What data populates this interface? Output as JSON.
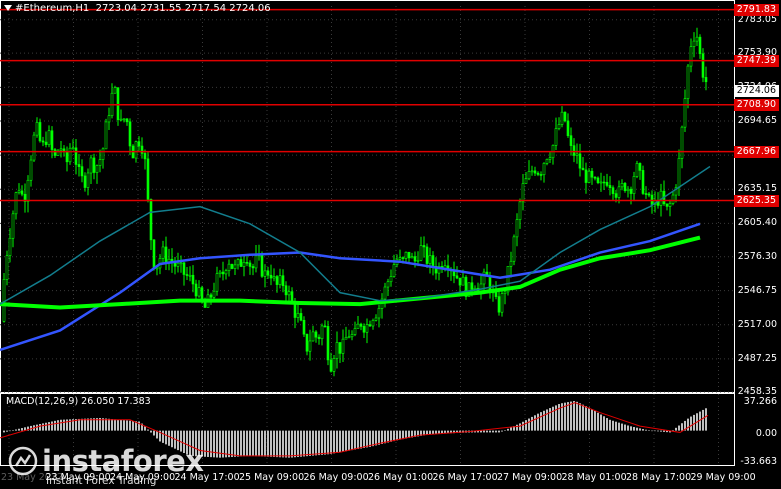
{
  "header": {
    "symbol": "#Ethereum,H1",
    "ohlc": "2723.04 2731.55 2717.54 2724.06"
  },
  "price_axis": {
    "ticks": [
      "2783.05",
      "2753.90",
      "2724.06",
      "2694.65",
      "2664.90",
      "2635.15",
      "2605.40",
      "2576.30",
      "2546.75",
      "2517.00",
      "2487.25",
      "2458.35"
    ],
    "current_price": "2724.06"
  },
  "levels": [
    {
      "label": "2791.83",
      "value": 2791.83
    },
    {
      "label": "2747.39",
      "value": 2747.39
    },
    {
      "label": "2708.90",
      "value": 2708.9
    },
    {
      "label": "2667.96",
      "value": 2667.96
    },
    {
      "label": "2625.35",
      "value": 2625.35
    }
  ],
  "time_axis": [
    "23 May 2022",
    "23 May 09:00",
    "24 May 09:00",
    "24 May 17:00",
    "25 May 09:00",
    "26 May 09:00",
    "26 May 01:00",
    "26 May 17:00",
    "27 May 09:00",
    "28 May 01:00",
    "28 May 17:00",
    "29 May 09:00"
  ],
  "macd": {
    "label": "MACD(12,26,9) 26.050 17.383",
    "ticks": [
      "37.266",
      "0.00",
      "-33.663"
    ]
  },
  "watermark": {
    "brand": "instaforex",
    "tagline": "Instant Forex Trading"
  },
  "colors": {
    "background": "#000000",
    "bull": "#00ff00",
    "levels": "#e00000",
    "ma_fast": "#3355ff",
    "ma_slow": "#00ff00",
    "ma_teal": "#127d8d",
    "signal": "#e00000",
    "hist": "#c0c0c0"
  },
  "chart_data": {
    "type": "candlestick",
    "symbol": "#Ethereum",
    "timeframe": "H1",
    "ylim": [
      2458.35,
      2795
    ],
    "close_path": [
      [
        0,
        2520
      ],
      [
        6,
        2575
      ],
      [
        12,
        2610
      ],
      [
        18,
        2640
      ],
      [
        24,
        2625
      ],
      [
        30,
        2660
      ],
      [
        36,
        2690
      ],
      [
        42,
        2670
      ],
      [
        48,
        2685
      ],
      [
        54,
        2660
      ],
      [
        60,
        2675
      ],
      [
        66,
        2655
      ],
      [
        72,
        2680
      ],
      [
        78,
        2650
      ],
      [
        84,
        2640
      ],
      [
        90,
        2660
      ],
      [
        96,
        2655
      ],
      [
        102,
        2665
      ],
      [
        108,
        2700
      ],
      [
        114,
        2725
      ],
      [
        120,
        2690
      ],
      [
        126,
        2700
      ],
      [
        132,
        2665
      ],
      [
        138,
        2680
      ],
      [
        144,
        2670
      ],
      [
        150,
        2600
      ],
      [
        155,
        2565
      ],
      [
        162,
        2580
      ],
      [
        168,
        2575
      ],
      [
        174,
        2570
      ],
      [
        180,
        2565
      ],
      [
        186,
        2560
      ],
      [
        192,
        2555
      ],
      [
        198,
        2545
      ],
      [
        204,
        2530
      ],
      [
        210,
        2540
      ],
      [
        216,
        2555
      ],
      [
        222,
        2560
      ],
      [
        228,
        2575
      ],
      [
        234,
        2565
      ],
      [
        240,
        2570
      ],
      [
        246,
        2580
      ],
      [
        252,
        2565
      ],
      [
        258,
        2575
      ],
      [
        264,
        2560
      ],
      [
        270,
        2565
      ],
      [
        276,
        2550
      ],
      [
        282,
        2555
      ],
      [
        288,
        2545
      ],
      [
        294,
        2530
      ],
      [
        300,
        2520
      ],
      [
        306,
        2495
      ],
      [
        312,
        2510
      ],
      [
        318,
        2505
      ],
      [
        324,
        2520
      ],
      [
        330,
        2480
      ],
      [
        336,
        2500
      ],
      [
        342,
        2495
      ],
      [
        348,
        2510
      ],
      [
        354,
        2505
      ],
      [
        360,
        2520
      ],
      [
        366,
        2515
      ],
      [
        372,
        2525
      ],
      [
        378,
        2530
      ],
      [
        384,
        2545
      ],
      [
        390,
        2560
      ],
      [
        396,
        2575
      ],
      [
        402,
        2570
      ],
      [
        408,
        2580
      ],
      [
        414,
        2570
      ],
      [
        420,
        2585
      ],
      [
        426,
        2575
      ],
      [
        432,
        2570
      ],
      [
        438,
        2565
      ],
      [
        444,
        2575
      ],
      [
        450,
        2570
      ],
      [
        456,
        2560
      ],
      [
        462,
        2555
      ],
      [
        468,
        2545
      ],
      [
        474,
        2555
      ],
      [
        480,
        2550
      ],
      [
        486,
        2560
      ],
      [
        492,
        2545
      ],
      [
        498,
        2530
      ],
      [
        504,
        2545
      ],
      [
        510,
        2570
      ],
      [
        516,
        2600
      ],
      [
        522,
        2635
      ],
      [
        528,
        2645
      ],
      [
        534,
        2655
      ],
      [
        540,
        2650
      ],
      [
        546,
        2665
      ],
      [
        552,
        2670
      ],
      [
        558,
        2690
      ],
      [
        564,
        2700
      ],
      [
        570,
        2670
      ],
      [
        576,
        2665
      ],
      [
        582,
        2650
      ],
      [
        588,
        2645
      ],
      [
        594,
        2640
      ],
      [
        600,
        2635
      ],
      [
        606,
        2645
      ],
      [
        612,
        2640
      ],
      [
        618,
        2630
      ],
      [
        624,
        2640
      ],
      [
        630,
        2635
      ],
      [
        636,
        2655
      ],
      [
        642,
        2640
      ],
      [
        648,
        2625
      ],
      [
        654,
        2620
      ],
      [
        660,
        2630
      ],
      [
        666,
        2615
      ],
      [
        672,
        2625
      ],
      [
        678,
        2650
      ],
      [
        684,
        2705
      ],
      [
        690,
        2760
      ],
      [
        696,
        2775
      ],
      [
        702,
        2740
      ],
      [
        708,
        2724
      ]
    ],
    "moving_averages": [
      {
        "name": "ma_fast",
        "color": "#3355ff",
        "points": [
          [
            0,
            2495
          ],
          [
            60,
            2512
          ],
          [
            120,
            2545
          ],
          [
            160,
            2570
          ],
          [
            200,
            2575
          ],
          [
            250,
            2578
          ],
          [
            300,
            2580
          ],
          [
            340,
            2575
          ],
          [
            400,
            2572
          ],
          [
            450,
            2565
          ],
          [
            500,
            2558
          ],
          [
            550,
            2565
          ],
          [
            600,
            2580
          ],
          [
            650,
            2590
          ],
          [
            700,
            2605
          ]
        ]
      },
      {
        "name": "ma_slow",
        "color": "#00ff00",
        "points": [
          [
            0,
            2535
          ],
          [
            60,
            2532
          ],
          [
            120,
            2535
          ],
          [
            180,
            2538
          ],
          [
            240,
            2538
          ],
          [
            300,
            2536
          ],
          [
            360,
            2535
          ],
          [
            420,
            2540
          ],
          [
            480,
            2545
          ],
          [
            520,
            2550
          ],
          [
            560,
            2565
          ],
          [
            600,
            2575
          ],
          [
            650,
            2582
          ],
          [
            700,
            2593
          ]
        ]
      },
      {
        "name": "ma_teal",
        "color": "#127d8d",
        "points": [
          [
            0,
            2535
          ],
          [
            50,
            2560
          ],
          [
            100,
            2590
          ],
          [
            150,
            2615
          ],
          [
            200,
            2620
          ],
          [
            250,
            2605
          ],
          [
            300,
            2580
          ],
          [
            340,
            2545
          ],
          [
            380,
            2538
          ],
          [
            420,
            2540
          ],
          [
            480,
            2548
          ],
          [
            520,
            2555
          ],
          [
            560,
            2580
          ],
          [
            600,
            2600
          ],
          [
            650,
            2620
          ],
          [
            710,
            2655
          ]
        ]
      }
    ],
    "macd": {
      "hist_path": [
        [
          0,
          -3
        ],
        [
          30,
          5
        ],
        [
          60,
          12
        ],
        [
          100,
          14
        ],
        [
          140,
          10
        ],
        [
          160,
          -12
        ],
        [
          190,
          -28
        ],
        [
          220,
          -30
        ],
        [
          250,
          -28
        ],
        [
          290,
          -30
        ],
        [
          330,
          -26
        ],
        [
          370,
          -18
        ],
        [
          400,
          -10
        ],
        [
          430,
          -4
        ],
        [
          470,
          -2
        ],
        [
          500,
          -2
        ],
        [
          520,
          8
        ],
        [
          540,
          20
        ],
        [
          560,
          30
        ],
        [
          575,
          33
        ],
        [
          590,
          25
        ],
        [
          610,
          12
        ],
        [
          630,
          5
        ],
        [
          650,
          0
        ],
        [
          670,
          -2
        ],
        [
          690,
          15
        ],
        [
          708,
          26
        ]
      ],
      "signal_path": [
        [
          0,
          -8
        ],
        [
          40,
          5
        ],
        [
          80,
          12
        ],
        [
          130,
          12
        ],
        [
          160,
          -2
        ],
        [
          200,
          -22
        ],
        [
          240,
          -28
        ],
        [
          290,
          -28
        ],
        [
          340,
          -24
        ],
        [
          380,
          -14
        ],
        [
          420,
          -5
        ],
        [
          470,
          -1
        ],
        [
          520,
          5
        ],
        [
          560,
          25
        ],
        [
          575,
          31
        ],
        [
          600,
          20
        ],
        [
          640,
          5
        ],
        [
          680,
          -2
        ],
        [
          708,
          17
        ]
      ]
    }
  }
}
